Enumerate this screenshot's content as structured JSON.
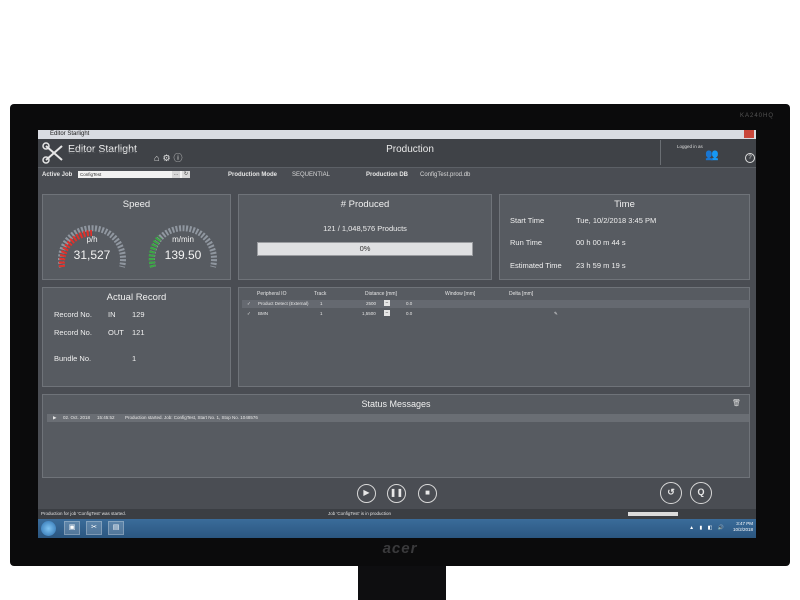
{
  "monitor": {
    "brand": "acer",
    "brand_top": "KA240HQ"
  },
  "window": {
    "title": "Editor Starlight"
  },
  "header": {
    "app_name": "Editor Starlight",
    "page_title": "Production",
    "logged_in_label": "Logged in as",
    "icons": [
      "home-icon",
      "gear-icon",
      "info-icon",
      "user-icon",
      "help-icon"
    ]
  },
  "job_bar": {
    "active_job_label": "Active Job",
    "active_job_value": "ConfigTest",
    "production_mode_label": "Production Mode",
    "production_mode_value": "SEQUENTIAL",
    "production_db_label": "Production DB",
    "production_db_value": "ConfigTest.prod.db"
  },
  "speed": {
    "title": "Speed",
    "gauges": [
      {
        "unit": "p/h",
        "value": "31,527",
        "color": "#e0312b"
      },
      {
        "unit": "m/min",
        "value": "139.50",
        "color": "#3aa843"
      }
    ]
  },
  "produced": {
    "title": "# Produced",
    "count_text": "121  /  1,048,576  Products",
    "progress_label": "0%",
    "progress_fraction": 0
  },
  "time": {
    "title": "Time",
    "rows": [
      {
        "label": "Start Time",
        "value": "Tue, 10/2/2018  3:45 PM"
      },
      {
        "label": "Run Time",
        "value": "00 h 00 m 44 s"
      },
      {
        "label": "Estimated Time",
        "value": "23 h 59 m 19 s"
      }
    ]
  },
  "actual_record": {
    "title": "Actual Record",
    "rows": [
      {
        "label": "Record No.",
        "sub": "IN",
        "value": "129"
      },
      {
        "label": "Record No.",
        "sub": "OUT",
        "value": "121"
      },
      {
        "label": "Bundle No.",
        "sub": "",
        "value": "1"
      }
    ]
  },
  "peripheral_table": {
    "headers": [
      "Peripheral IO",
      "Track",
      "Distance [mm]",
      "Window [mm]",
      "Delta [mm]"
    ],
    "rows": [
      {
        "check": "✓",
        "name": "Product Detect (External)",
        "track": "1",
        "distance": "2500",
        "window": "0.0"
      },
      {
        "check": "✓",
        "name": "BMN",
        "track": "1",
        "distance": "1,5500",
        "window": "0.0"
      }
    ]
  },
  "status_messages": {
    "title": "Status Messages",
    "rows": [
      {
        "date": "02. Oct. 2018",
        "time": "15:45:52",
        "text": "Production started. Job: ConfigTest, Start No. 1, Stop No. 1048576"
      }
    ]
  },
  "controls": [
    "play",
    "pause",
    "stop",
    "reset",
    "search"
  ],
  "status_bar": {
    "left": "Production for job 'ConfigTest' was started.",
    "middle": "Job 'ConfigTest' is in production"
  },
  "taskbar": {
    "time": "3:47 PM",
    "date": "10/2/2018"
  }
}
